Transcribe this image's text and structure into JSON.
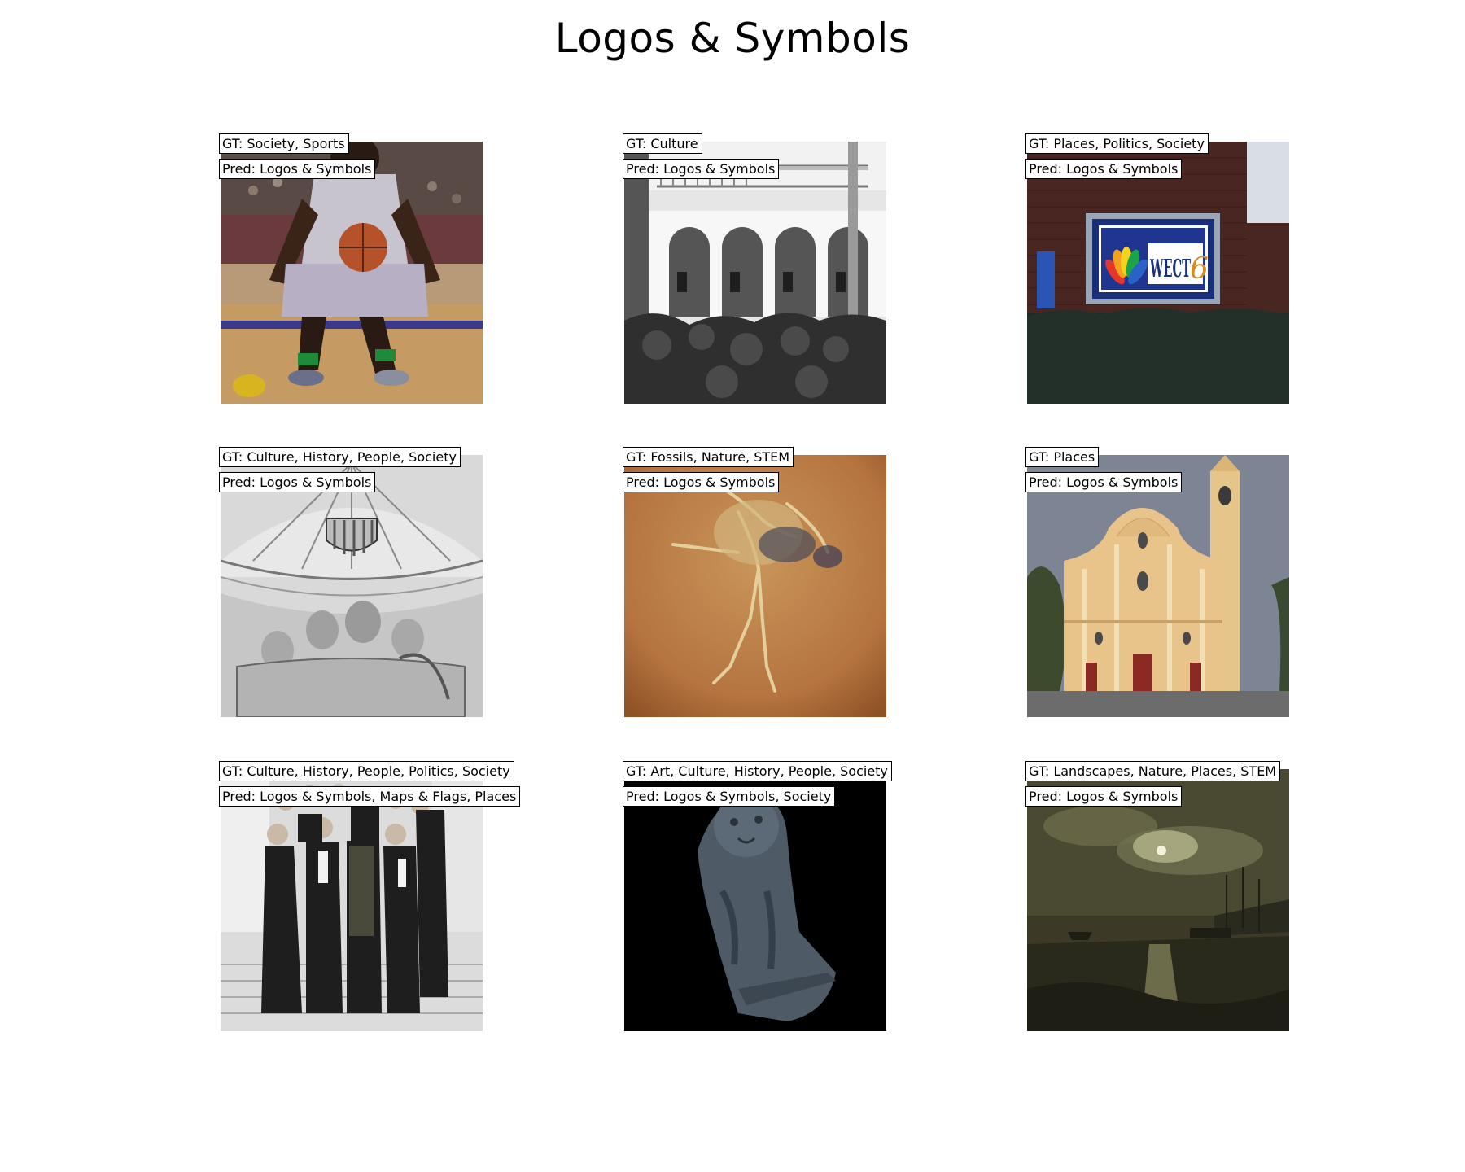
{
  "title": "Logos & Symbols",
  "items": [
    {
      "gt": "GT: Society, Sports",
      "pred": "Pred: Logos & Symbols",
      "subject": "basketball-player"
    },
    {
      "gt": "GT: Culture",
      "pred": "Pred: Logos & Symbols",
      "subject": "arcaded-courtyard"
    },
    {
      "gt": "GT: Places, Politics, Society",
      "pred": "Pred: Logos & Symbols",
      "subject": "tv-station-sign",
      "sign_text": "WECT",
      "sign_number": "6"
    },
    {
      "gt": "GT: Culture, History, People, Society",
      "pred": "Pred: Logos & Symbols",
      "subject": "medieval-fresco"
    },
    {
      "gt": "GT: Fossils, Nature, STEM",
      "pred": "Pred: Logos & Symbols",
      "subject": "bird-fossil"
    },
    {
      "gt": "GT: Places",
      "pred": "Pred: Logos & Symbols",
      "subject": "church-facade"
    },
    {
      "gt": "GT: Culture, History, People, Politics, Society",
      "pred": "Pred: Logos & Symbols, Maps & Flags, Places",
      "subject": "group-photo"
    },
    {
      "gt": "GT: Art, Culture, History, People, Society",
      "pred": "Pred: Logos & Symbols, Society",
      "subject": "lion-statuette"
    },
    {
      "gt": "GT: Landscapes, Nature, Places, STEM",
      "pred": "Pred: Logos & Symbols",
      "subject": "moonlit-harbor-painting"
    }
  ]
}
